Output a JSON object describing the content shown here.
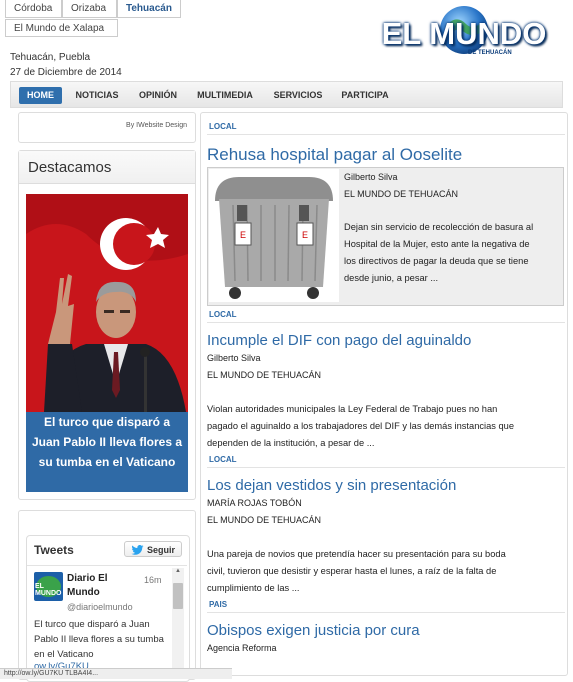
{
  "city_tabs": [
    "Córdoba",
    "Orizaba",
    "Tehuacán",
    "El Mundo de Xalapa"
  ],
  "logo": {
    "title": "EL MUNDO",
    "tagline_left": "TU MUNDO",
    "tagline_right": "A DIARIO",
    "sub": "DE TEHUACÁN"
  },
  "location": "Tehuacán, Puebla",
  "date": "27 de Diciembre de 2014",
  "nav": [
    "HOME",
    "NOTICIAS",
    "OPINIÓN",
    "MULTIMEDIA",
    "SERVICIOS",
    "PARTICIPA"
  ],
  "credit": "By IWebsite Design",
  "destacamos": {
    "title": "Destacamos",
    "caption": "El turco que disparó a Juan Pablo II lleva flores a su tumba en el Vaticano"
  },
  "tweets": {
    "title": "Tweets",
    "follow": "Seguir",
    "tweet": {
      "name": "Diario El Mundo",
      "time": "16m",
      "handle": "@diarioelmundo",
      "text": "El turco que disparó a Juan Pablo II lleva flores a su tumba en el Vaticano",
      "link": "ow.ly/Gu7KU"
    }
  },
  "articles": [
    {
      "section": "LOCAL",
      "headline": "Rehusa hospital pagar al Ooselite",
      "author": "Gilberto Silva",
      "source": "EL MUNDO DE TEHUACÁN",
      "summary_lines": [
        "Dejan sin servicio de recolección de basura al",
        "Hospital de la Mujer, esto ante la negativa de",
        "los directivos de pagar la deuda que se tiene",
        "desde junio, a pesar ..."
      ]
    },
    {
      "section": "LOCAL",
      "headline": "Incumple el DIF con pago del aguinaldo",
      "author": "Gilberto Silva",
      "source": "EL MUNDO DE TEHUACÁN",
      "summary_lines": [
        "Violan autoridades municipales la Ley Federal de Trabajo pues no han",
        "pagado el aguinaldo a los trabajadores del DIF y las demás instancias que",
        "dependen de la institución, a pesar de ..."
      ]
    },
    {
      "section": "LOCAL",
      "headline": "Los dejan vestidos y sin presentación",
      "author": "MARÍA ROJAS TOBÓN",
      "source": "EL MUNDO DE TEHUACÁN",
      "summary_lines": [
        "Una pareja de novios que pretendía hacer su presentación para su boda",
        "civil, tuvieron que desistir y esperar hasta el lunes, a raíz de la falta de",
        "cumplimiento de las ..."
      ]
    },
    {
      "section": "PAIS",
      "headline": "Obispos exigen justicia por cura",
      "author": "Agencia Reforma"
    }
  ],
  "status_bar": "http://ow.ly/GU7KU TLBA4I4..."
}
